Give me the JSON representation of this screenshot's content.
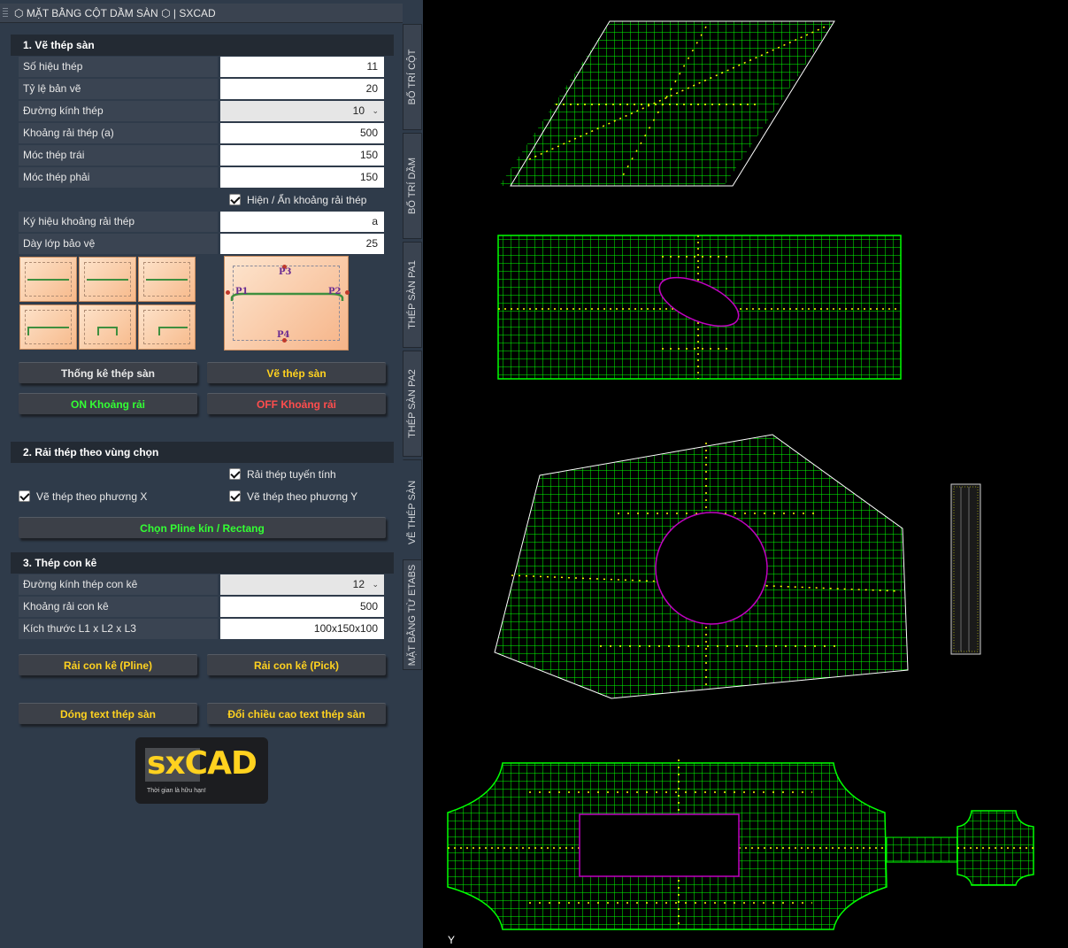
{
  "window": {
    "title": "MẶT BẰNG CỘT DẦM SÀN",
    "title_suffix": " | SXCAD"
  },
  "section1": {
    "header": "1.   Vẽ thép sàn",
    "rows": [
      {
        "label": "Số hiệu thép",
        "value": "11"
      },
      {
        "label": "Tỷ lệ bản vẽ",
        "value": "20"
      },
      {
        "label": "Đường kính thép",
        "value": "10"
      },
      {
        "label": "Khoảng rải thép (a)",
        "value": "500"
      },
      {
        "label": "Móc thép trái",
        "value": "150"
      },
      {
        "label": "Móc thép phải",
        "value": "150"
      }
    ],
    "toggle_spacing": "Hiện / Ẩn khoảng rải thép",
    "rows2": [
      {
        "label": "Ký hiệu khoảng rải thép",
        "value": "a"
      },
      {
        "label": "Dày lớp bảo vệ",
        "value": "25"
      }
    ],
    "diagram_points": [
      "P1",
      "P2",
      "P3",
      "P4"
    ],
    "buttons": {
      "stats": "Thống kê thép sàn",
      "draw": "Vẽ thép sàn",
      "on_spacing": "ON Khoảng rải",
      "off_spacing": "OFF Khoảng rải"
    }
  },
  "section2": {
    "header": "2.   Rải thép theo vùng chọn",
    "linear": "Rải thép tuyến tính",
    "dir_x": "Vẽ thép theo phương X",
    "dir_y": "Vẽ thép theo phương Y",
    "select_button": "Chọn Pline kín / Rectang"
  },
  "section3": {
    "header": "3.   Thép con kê",
    "rows": [
      {
        "label": "Đường kính thép con kê",
        "value": "12"
      },
      {
        "label": "Khoảng rải con kê",
        "value": "500"
      },
      {
        "label": "Kích thước L1 x L2 x L3",
        "value": "100x150x100"
      }
    ],
    "btn_pline": "Rải con kê (Pline)",
    "btn_pick": "Rải con kê (Pick)"
  },
  "footer_buttons": {
    "close_text": "Dóng text thép sàn",
    "swap_height": "Đổi chiều cao text thép sàn"
  },
  "logo": {
    "sx": "sx",
    "cad": "CAD",
    "tagline": "Thời gian là hữu hạn!"
  },
  "side_tabs": [
    "BỐ TRÍ CỘT",
    "BỐ TRÍ DẦM",
    "THÉP SÀN PA1",
    "THÉP SÀN PA2",
    "VẼ THÉP SÀN",
    "MẶT BẰNG TỪ ETABS"
  ],
  "canvas": {
    "ucs_label": "Y"
  },
  "colors": {
    "grid": "#00ff00",
    "rebar_marks": "#ffff00",
    "outline": "#ffffff",
    "hole": "#c000c0",
    "button_green": "#33ff33",
    "button_yellow": "#ffd21f",
    "button_red": "#ff4d4d"
  }
}
